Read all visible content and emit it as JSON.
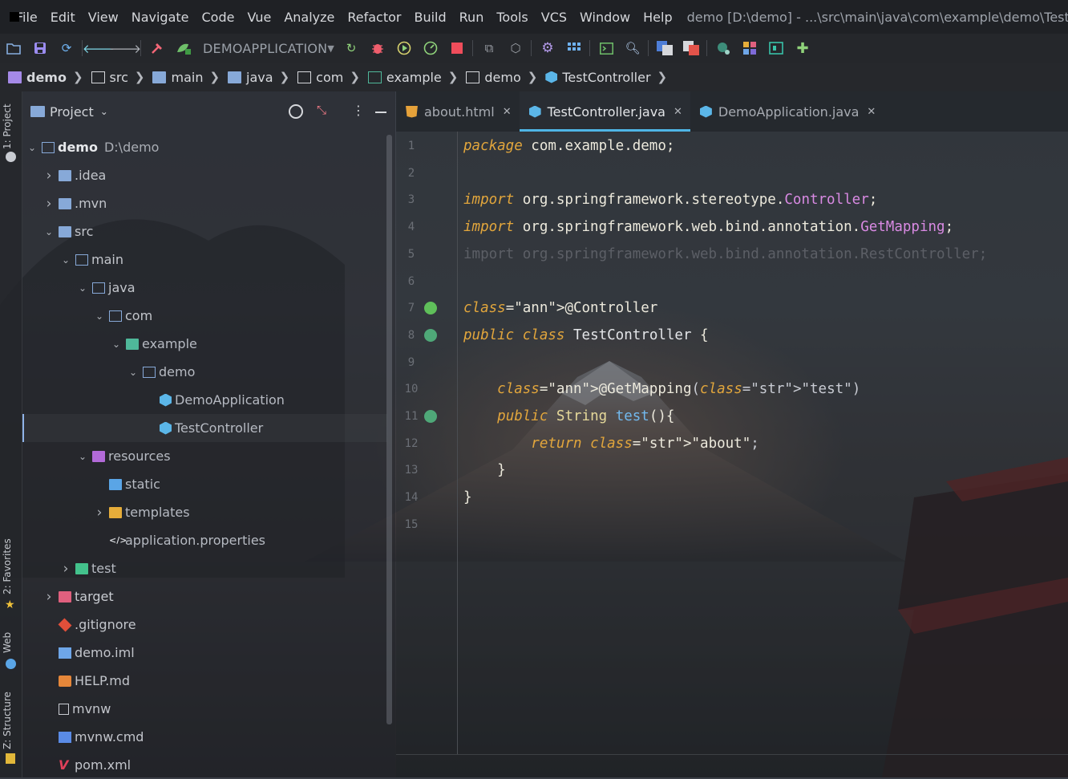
{
  "window": {
    "title": "demo [D:\\demo] - ...\\src\\main\\java\\com\\example\\demo\\TestControll"
  },
  "menu": [
    "File",
    "Edit",
    "View",
    "Navigate",
    "Code",
    "Vue",
    "Analyze",
    "Refactor",
    "Build",
    "Run",
    "Tools",
    "VCS",
    "Window",
    "Help"
  ],
  "toolbar": {
    "run_config": "DEMOAPPLICATION",
    "icons": [
      "open-folder-icon",
      "save-icon",
      "sync-icon",
      "back-icon",
      "forward-icon",
      "build-hammer-icon",
      "run-config-icon",
      "dropdown-icon",
      "rerun-icon",
      "debug-icon",
      "run-coverage-icon",
      "profiler-icon",
      "stop-icon",
      "attach-icon",
      "deploy-icon",
      "settings-icon",
      "project-structure-icon",
      "terminal-icon",
      "search-icon",
      "translate-icon",
      "translate-alt-icon",
      "plugin-a-icon",
      "plugin-b-icon",
      "plugin-c-icon",
      "plugin-d-icon"
    ]
  },
  "breadcrumb": [
    "demo",
    "src",
    "main",
    "java",
    "com",
    "example",
    "demo",
    "TestController"
  ],
  "left_strip": {
    "project_label": "1: Project",
    "favorites_label": "2: Favorites",
    "web_label": "Web",
    "structure_label": "Z: Structure"
  },
  "project_panel": {
    "title": "Project",
    "tree": [
      {
        "label": "demo",
        "suffix": "D:\\demo",
        "depth": 0,
        "arrow": "down",
        "icon": "folder-icon",
        "bold": true
      },
      {
        "label": ".idea",
        "depth": 1,
        "arrow": "right",
        "icon": "idea-folder-icon"
      },
      {
        "label": ".mvn",
        "depth": 1,
        "arrow": "right",
        "icon": "folder-icon"
      },
      {
        "label": "src",
        "depth": 1,
        "arrow": "down",
        "icon": "source-folder-icon"
      },
      {
        "label": "main",
        "depth": 2,
        "arrow": "down",
        "icon": "folder-icon"
      },
      {
        "label": "java",
        "depth": 3,
        "arrow": "down",
        "icon": "folder-icon"
      },
      {
        "label": "com",
        "depth": 4,
        "arrow": "down",
        "icon": "folder-icon"
      },
      {
        "label": "example",
        "depth": 5,
        "arrow": "down",
        "icon": "package-icon"
      },
      {
        "label": "demo",
        "depth": 6,
        "arrow": "down",
        "icon": "folder-icon"
      },
      {
        "label": "DemoApplication",
        "depth": 7,
        "arrow": "",
        "icon": "spring-class-icon"
      },
      {
        "label": "TestController",
        "depth": 7,
        "arrow": "",
        "icon": "class-icon",
        "selected": true
      },
      {
        "label": "resources",
        "depth": 3,
        "arrow": "down",
        "icon": "resources-folder-icon"
      },
      {
        "label": "static",
        "depth": 4,
        "arrow": "",
        "icon": "web-folder-icon"
      },
      {
        "label": "templates",
        "depth": 4,
        "arrow": "right",
        "icon": "templates-folder-icon"
      },
      {
        "label": "application.properties",
        "depth": 4,
        "arrow": "",
        "icon": "properties-icon"
      },
      {
        "label": "test",
        "depth": 2,
        "arrow": "right",
        "icon": "test-folder-icon"
      },
      {
        "label": "target",
        "depth": 1,
        "arrow": "right",
        "icon": "excluded-folder-icon"
      },
      {
        "label": ".gitignore",
        "depth": 1,
        "arrow": "",
        "icon": "git-icon"
      },
      {
        "label": "demo.iml",
        "depth": 1,
        "arrow": "",
        "icon": "iml-icon"
      },
      {
        "label": "HELP.md",
        "depth": 1,
        "arrow": "",
        "icon": "markdown-icon"
      },
      {
        "label": "mvnw",
        "depth": 1,
        "arrow": "",
        "icon": "text-file-icon"
      },
      {
        "label": "mvnw.cmd",
        "depth": 1,
        "arrow": "",
        "icon": "cmd-icon"
      },
      {
        "label": "pom.xml",
        "depth": 1,
        "arrow": "",
        "icon": "maven-icon"
      }
    ]
  },
  "editor": {
    "tabs": [
      {
        "label": "about.html",
        "icon": "html-icon",
        "active": false
      },
      {
        "label": "TestController.java",
        "icon": "class-icon",
        "active": true
      },
      {
        "label": "DemoApplication.java",
        "icon": "spring-class-icon",
        "active": false
      }
    ],
    "lines": [
      "package com.example.demo;",
      "",
      "import org.springframework.stereotype.Controller;",
      "import org.springframework.web.bind.annotation.GetMapping;",
      "import org.springframework.web.bind.annotation.RestController;",
      "",
      "@Controller",
      "public class TestController {",
      "",
      "    @GetMapping(\"test\")",
      "    public String test(){",
      "        return \"about\";",
      "    }",
      "}",
      ""
    ],
    "line_numbers": [
      "1",
      "2",
      "3",
      "4",
      "5",
      "6",
      "7",
      "8",
      "9",
      "10",
      "11",
      "12",
      "13",
      "14",
      "15"
    ]
  }
}
